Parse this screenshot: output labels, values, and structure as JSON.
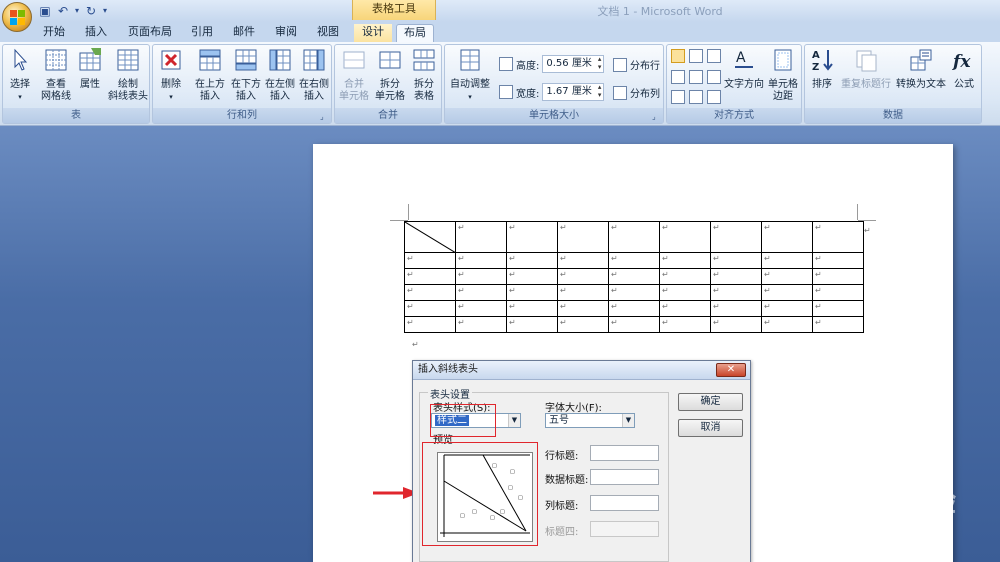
{
  "app": {
    "window_title": "文档 1 - Microsoft Word",
    "tool_group": "表格工具"
  },
  "tabs": [
    {
      "label": "开始"
    },
    {
      "label": "插入"
    },
    {
      "label": "页面布局"
    },
    {
      "label": "引用"
    },
    {
      "label": "邮件"
    },
    {
      "label": "审阅"
    },
    {
      "label": "视图"
    },
    {
      "label": "设计"
    },
    {
      "label": "布局"
    }
  ],
  "selected_tab": "布局",
  "ribbon": {
    "groups": {
      "table": {
        "label": "表",
        "select": "选择",
        "gridlines_1": "查看",
        "gridlines_2": "网格线",
        "properties": "属性",
        "diag_1": "绘制",
        "diag_2": "斜线表头"
      },
      "rows_cols": {
        "label": "行和列",
        "delete": "删除",
        "above_1": "在上方",
        "above_2": "插入",
        "below_1": "在下方",
        "below_2": "插入",
        "left_1": "在左侧",
        "left_2": "插入",
        "right_1": "在右侧",
        "right_2": "插入"
      },
      "merge": {
        "label": "合并",
        "merge_1": "合并",
        "merge_2": "单元格",
        "split_1": "拆分",
        "split_2": "单元格",
        "split_table_1": "拆分",
        "split_table_2": "表格"
      },
      "cell_size": {
        "label": "单元格大小",
        "autofit": "自动调整",
        "height_label": "高度:",
        "height_value": "0.56 厘米",
        "width_label": "宽度:",
        "width_value": "1.67 厘米",
        "dist_rows": "分布行",
        "dist_cols": "分布列"
      },
      "alignment": {
        "label": "对齐方式",
        "text_dir": "文字方向",
        "margins_1": "单元格",
        "margins_2": "边距"
      },
      "data": {
        "label": "数据",
        "sort": "排序",
        "repeat_header": "重复标题行",
        "convert": "转换为文本",
        "formula": "公式"
      }
    }
  },
  "document": {
    "para_mark": "↵",
    "table": {
      "rows": 6,
      "cols": 9,
      "first_cell_diagonal": true
    }
  },
  "dialog": {
    "title": "插入斜线表头",
    "close": "✕",
    "group_label": "表头设置",
    "style_label": "表头样式(S):",
    "style_value": "样式二",
    "font_label": "字体大小(F):",
    "font_value": "五号",
    "preview_label": "预览",
    "row_title": "行标题:",
    "data_title": "数据标题:",
    "col_title": "列标题:",
    "title4": "标题四:",
    "ok": "确定",
    "cancel": "取消"
  },
  "watermark": {
    "brand": "Bai",
    "brand2": "du",
    "cn": "经验",
    "url": "jingyan.baidu.com"
  },
  "colors": {
    "ribbon_bg": "#dbe7f5",
    "doc_bg": "#4a6da6",
    "highlight": "#e0262d",
    "selection": "#3169c6"
  }
}
